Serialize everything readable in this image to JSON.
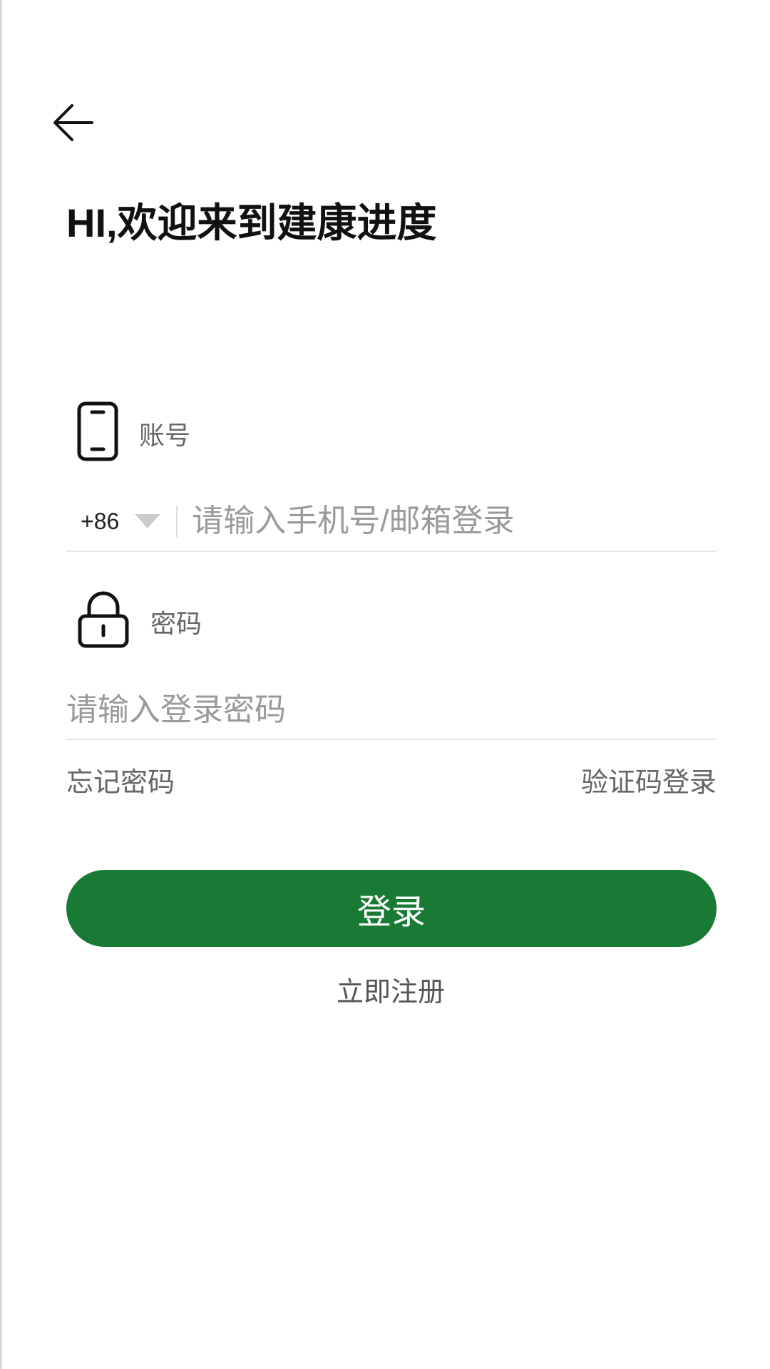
{
  "header": {
    "back_icon": "arrow-left-icon",
    "greeting": "HI,欢迎来到建康进度"
  },
  "account": {
    "icon": "phone-icon",
    "label": "账号",
    "country_code": "+86",
    "dropdown_icon": "caret-down-icon",
    "placeholder": "请输入手机号/邮箱登录",
    "value": ""
  },
  "password": {
    "icon": "lock-icon",
    "label": "密码",
    "placeholder": "请输入登录密码",
    "value": ""
  },
  "links": {
    "forgot_password": "忘记密码",
    "sms_login": "验证码登录"
  },
  "actions": {
    "login_label": "登录",
    "register_label": "立即注册"
  },
  "colors": {
    "primary": "#187a33",
    "placeholder": "#9a9a9a",
    "label": "#666666",
    "divider": "#e6e6e6"
  }
}
